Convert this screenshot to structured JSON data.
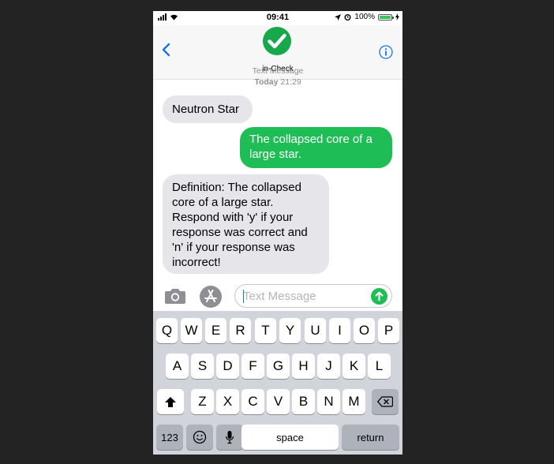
{
  "status_bar": {
    "time": "09:41",
    "battery_percent_label": "100%",
    "battery_level": 1.0,
    "icons": [
      "signal-bars-icon",
      "wifi-icon",
      "location-arrow-icon",
      "alarm-icon",
      "battery-icon",
      "charging-bolt-icon"
    ]
  },
  "header": {
    "contact_name": "in-Check",
    "back_icon": "chevron-left-icon",
    "info_icon": "info-icon",
    "avatar_icon": "checkmark-icon"
  },
  "conversation": {
    "service_label": "Text Message",
    "timestamp_day": "Today",
    "timestamp_time": "21:29",
    "messages": [
      {
        "direction": "received",
        "text": "Neutron Star"
      },
      {
        "direction": "sent",
        "text": "The collapsed core of a large star."
      },
      {
        "direction": "received",
        "text": "Definition: The collapsed core of a large star. Respond with 'y' if your response was correct and 'n' if your response was incorrect!"
      }
    ]
  },
  "composer": {
    "placeholder": "Text Message",
    "value": "",
    "camera_icon": "camera-icon",
    "appstore_icon": "app-store-icon",
    "send_icon": "send-arrow-icon"
  },
  "keyboard": {
    "row1": [
      "Q",
      "W",
      "E",
      "R",
      "T",
      "Y",
      "U",
      "I",
      "O",
      "P"
    ],
    "row2": [
      "A",
      "S",
      "D",
      "F",
      "G",
      "H",
      "J",
      "K",
      "L"
    ],
    "row3": [
      "Z",
      "X",
      "C",
      "V",
      "B",
      "N",
      "M"
    ],
    "numbers_label": "123",
    "space_label": "space",
    "return_label": "return",
    "icons": [
      "shift-icon",
      "backspace-icon",
      "emoji-icon",
      "microphone-icon"
    ]
  },
  "colors": {
    "sent_bubble": "#1fbd55",
    "received_bubble": "#e5e5ea",
    "accent": "#1a73e8",
    "keyboard_bg": "#d1d4db"
  }
}
